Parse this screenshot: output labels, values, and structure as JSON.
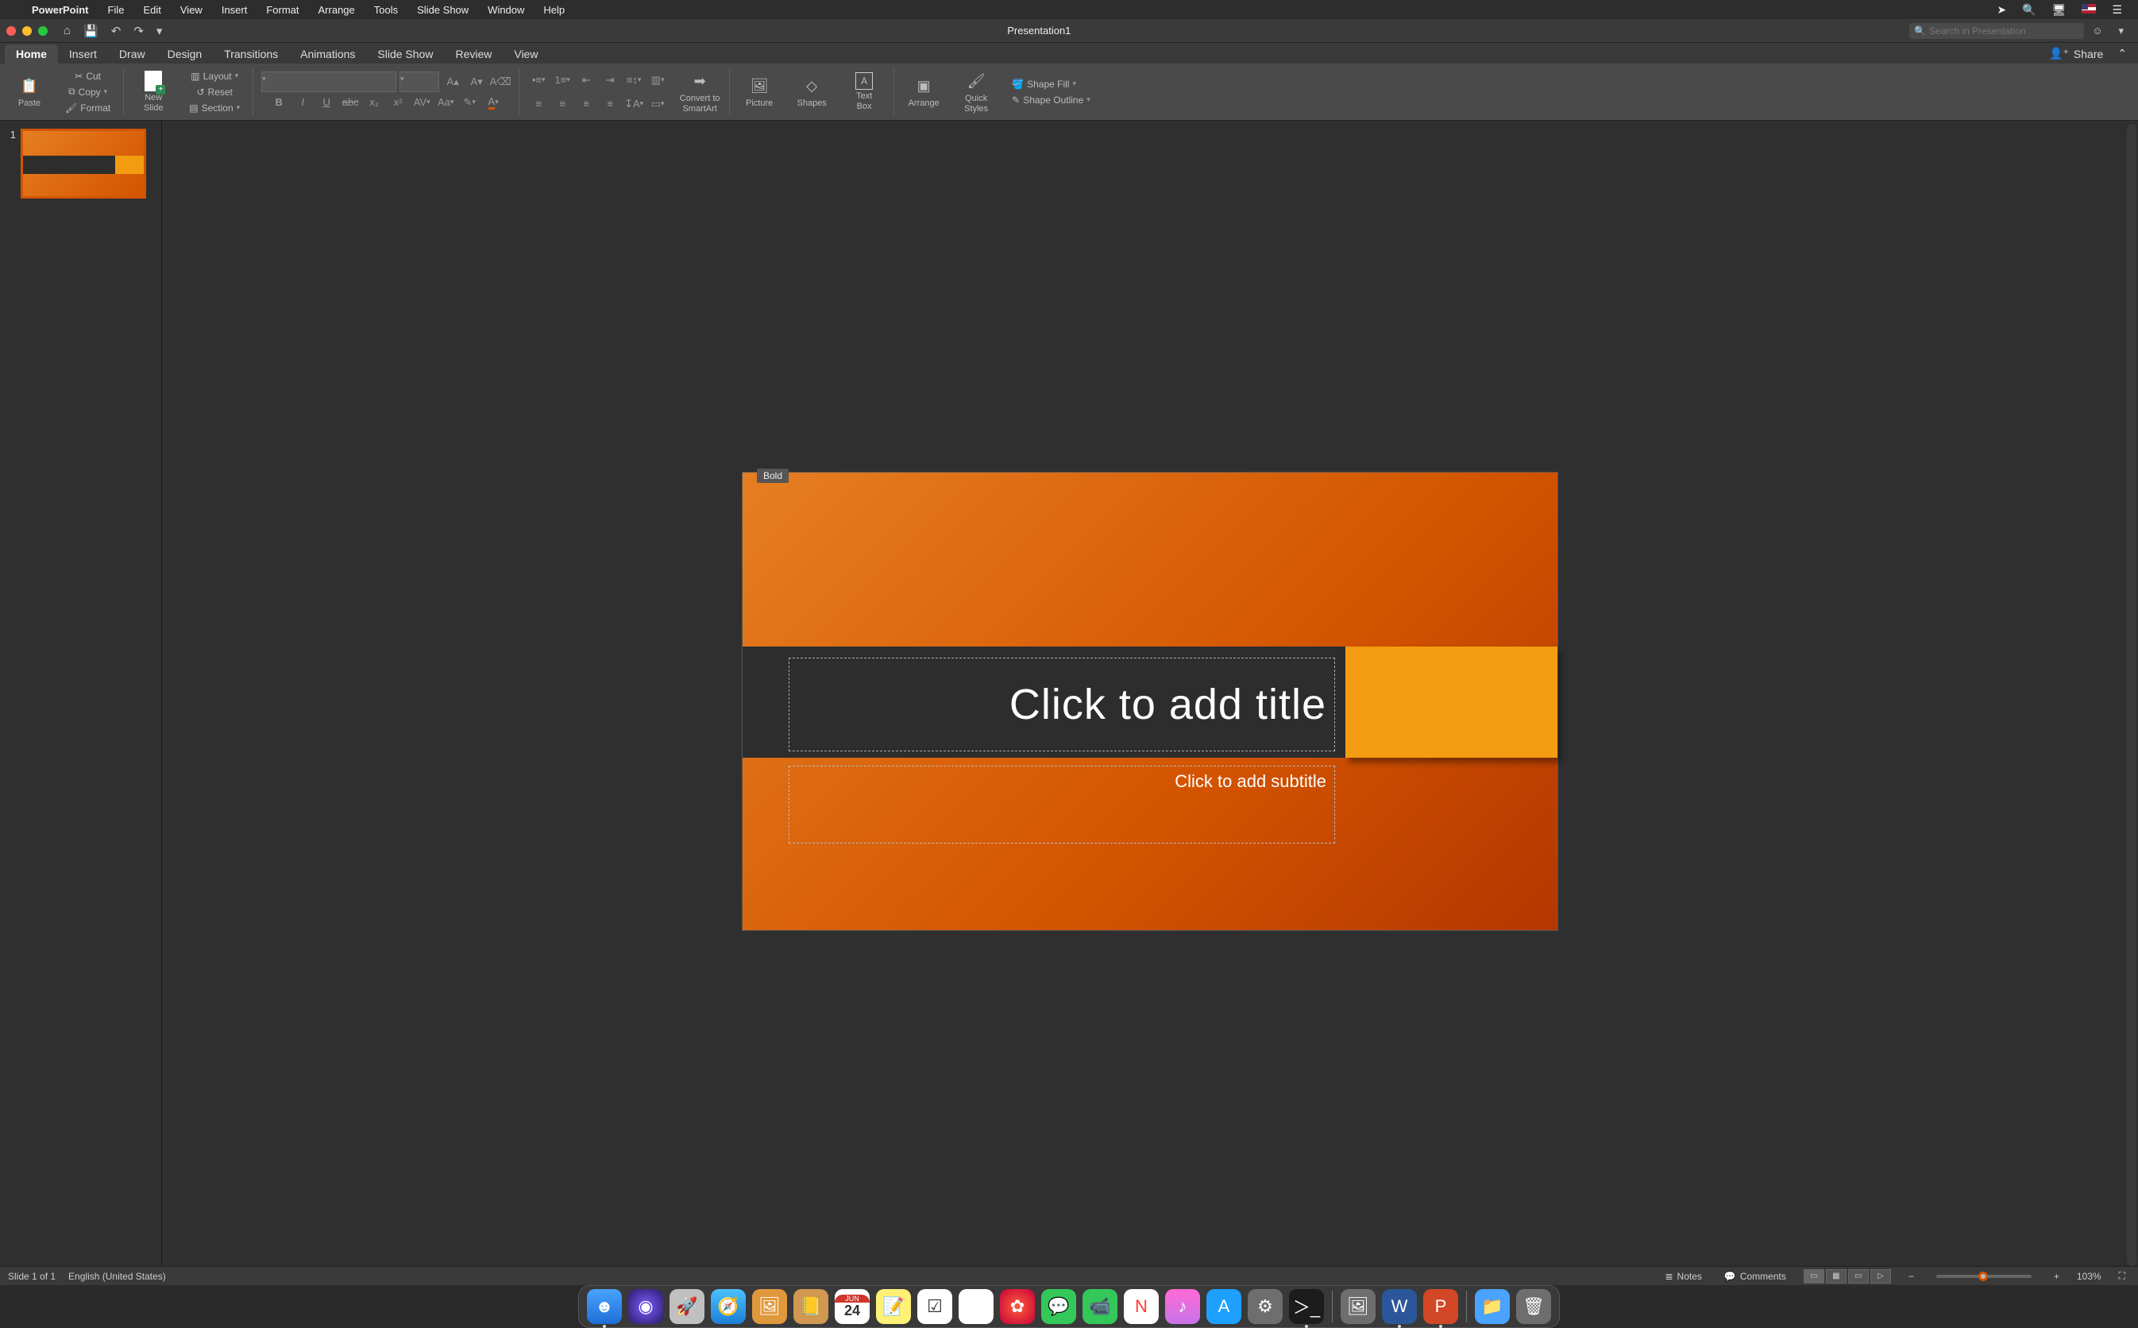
{
  "menubar": {
    "appname": "PowerPoint",
    "items": [
      "File",
      "Edit",
      "View",
      "Insert",
      "Format",
      "Arrange",
      "Tools",
      "Slide Show",
      "Window",
      "Help"
    ]
  },
  "titlebar": {
    "doc_title": "Presentation1",
    "search_placeholder": "Search in Presentation"
  },
  "ribbon_tabs": {
    "tabs": [
      "Home",
      "Insert",
      "Draw",
      "Design",
      "Transitions",
      "Animations",
      "Slide Show",
      "Review",
      "View"
    ],
    "active": "Home",
    "share": "Share"
  },
  "ribbon": {
    "paste": "Paste",
    "cut": "Cut",
    "copy": "Copy",
    "format_painter": "Format",
    "new_slide": "New\nSlide",
    "layout": "Layout",
    "reset": "Reset",
    "section": "Section",
    "convert_smartart": "Convert to\nSmartArt",
    "picture": "Picture",
    "shapes": "Shapes",
    "textbox": "Text\nBox",
    "arrange": "Arrange",
    "quick_styles": "Quick\nStyles",
    "shape_fill": "Shape Fill",
    "shape_outline": "Shape Outline"
  },
  "tooltip": "Bold",
  "thumbs": {
    "slide1_num": "1"
  },
  "slide": {
    "title_placeholder": "Click to add title",
    "subtitle_placeholder": "Click to add subtitle"
  },
  "statusbar": {
    "slide_pos": "Slide 1 of 1",
    "language": "English (United States)",
    "notes": "Notes",
    "comments": "Comments",
    "zoom": "103%"
  },
  "dock": {
    "cal_month": "JUN",
    "cal_day": "24"
  }
}
